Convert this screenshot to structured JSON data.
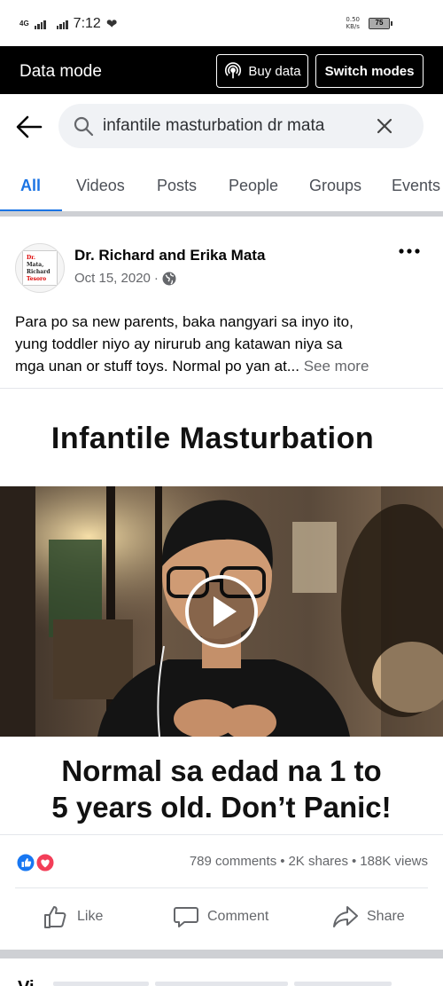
{
  "status_bar": {
    "network": "4G",
    "time": "7:12",
    "speed_value": "0.50",
    "speed_unit": "KB/s",
    "battery": "75"
  },
  "data_mode": {
    "title": "Data mode",
    "buy_label": "Buy data",
    "switch_label": "Switch modes"
  },
  "search": {
    "query": "infantile masturbation dr mata"
  },
  "tabs": [
    {
      "label": "All",
      "active": true
    },
    {
      "label": "Videos",
      "active": false
    },
    {
      "label": "Posts",
      "active": false
    },
    {
      "label": "People",
      "active": false
    },
    {
      "label": "Groups",
      "active": false
    },
    {
      "label": "Events",
      "active": false
    }
  ],
  "post": {
    "avatar_text": [
      "Dr.",
      "Mata,",
      "Richard",
      "Tesoro"
    ],
    "author": "Dr. Richard and Erika Mata",
    "date": "Oct 15, 2020",
    "separator": "·",
    "text_lines": [
      "Para po sa new parents, baka nangyari sa inyo ito,",
      "yung toddler niyo ay nirurub ang katawan niya sa",
      "mga unan or stuff toys. Normal po yan at..."
    ],
    "see_more": "See more",
    "video_title": "Infantile Masturbation",
    "video_caption_lines": [
      "Normal sa edad na 1 to",
      "5 years old. Don’t Panic!"
    ],
    "comments": "789 comments",
    "shares": "2K shares",
    "views": "188K views",
    "dot": "•"
  },
  "actions": {
    "like": "Like",
    "comment": "Comment",
    "share": "Share"
  },
  "next_section": {
    "heading": "Vi"
  },
  "colors": {
    "accent": "#1b74e4",
    "like_blue": "#1877f2",
    "love_red": "#f33e58"
  }
}
